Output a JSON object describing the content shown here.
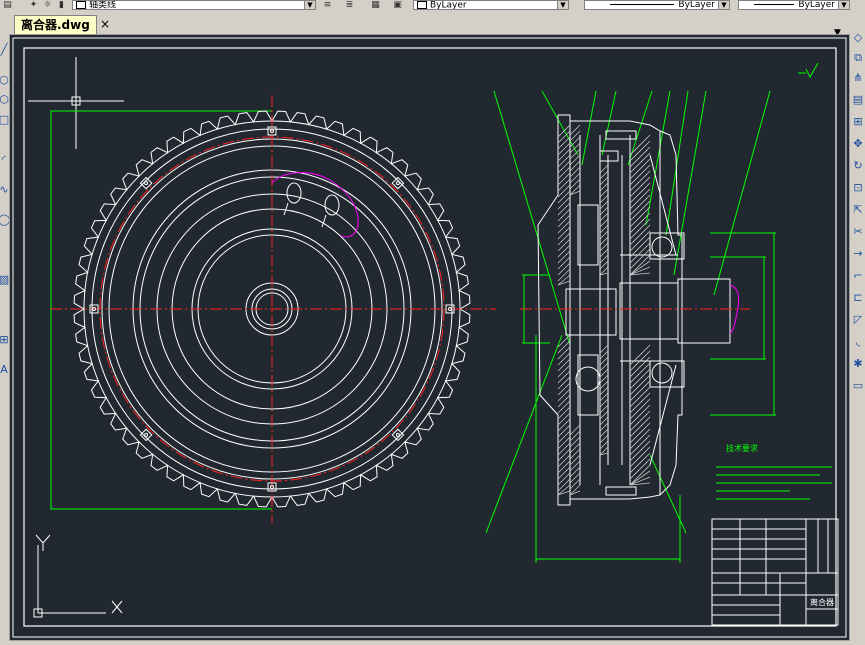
{
  "toolbar": {
    "layer_name": "轴类线",
    "color_value": "ByLayer",
    "linetype_value": "ByLayer",
    "lineweight_value": "ByLayer"
  },
  "document_tab": {
    "title": "离合器.dwg",
    "close_glyph": "×"
  },
  "drawing": {
    "tech_requirements_title": "技术要求",
    "title_block_name": "离合器"
  },
  "colors": {
    "canvas_background": "#212830",
    "geometry": "#ffffff",
    "dimension": "#00ff00",
    "center_line": "#ff2020",
    "hatch": "#c8c8c8",
    "section_highlight": "#ff00ff"
  },
  "icons": [
    "layer-icon",
    "light-bulb-icon",
    "sun-icon",
    "lock-icon",
    "color-icon",
    "chevron-down-icon",
    "line-tool-icon",
    "circle-tool-icon",
    "arc-tool-icon",
    "rectangle-tool-icon",
    "move-icon",
    "copy-icon",
    "rotate-icon",
    "scale-icon",
    "mirror-icon",
    "trim-icon",
    "extend-icon",
    "ucs-icon"
  ]
}
